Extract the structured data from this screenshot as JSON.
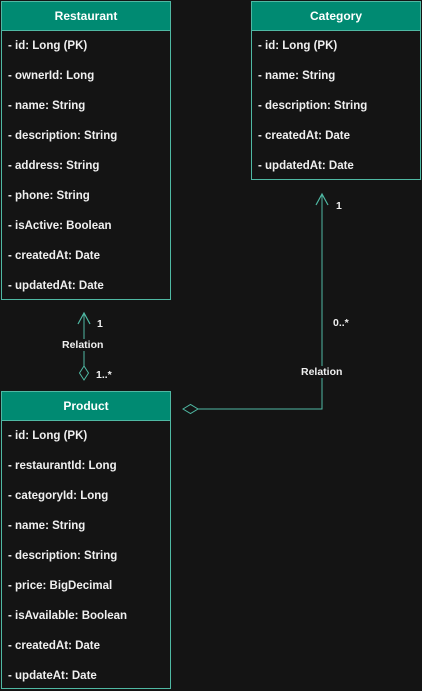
{
  "entities": {
    "restaurant": {
      "name": "Restaurant",
      "fields": [
        "- id: Long (PK)",
        "- ownerId: Long",
        "- name: String",
        "- description: String",
        "- address: String",
        "- phone: String",
        "- isActive: Boolean",
        "- createdAt: Date",
        "- updatedAt: Date"
      ]
    },
    "category": {
      "name": "Category",
      "fields": [
        "- id: Long (PK)",
        "- name: String",
        "- description: String",
        "- createdAt: Date",
        "- updatedAt: Date"
      ]
    },
    "product": {
      "name": "Product",
      "fields": [
        "- id: Long (PK)",
        "- restaurantId: Long",
        "- categoryId: Long",
        "- name: String",
        "- description: String",
        "- price: BigDecimal",
        "- isAvailable: Boolean",
        "- createdAt: Date",
        "- updateAt: Date"
      ]
    }
  },
  "relations": {
    "restaurant_product": {
      "label": "Relation",
      "source_multiplicity": "1",
      "target_multiplicity": "1..*"
    },
    "category_product": {
      "label": "Relation",
      "source_multiplicity": "1",
      "target_multiplicity": "0..*"
    }
  },
  "colors": {
    "background": "#141414",
    "header": "#008a72",
    "border": "#4fb8a3",
    "text": "#f0f0f0"
  }
}
